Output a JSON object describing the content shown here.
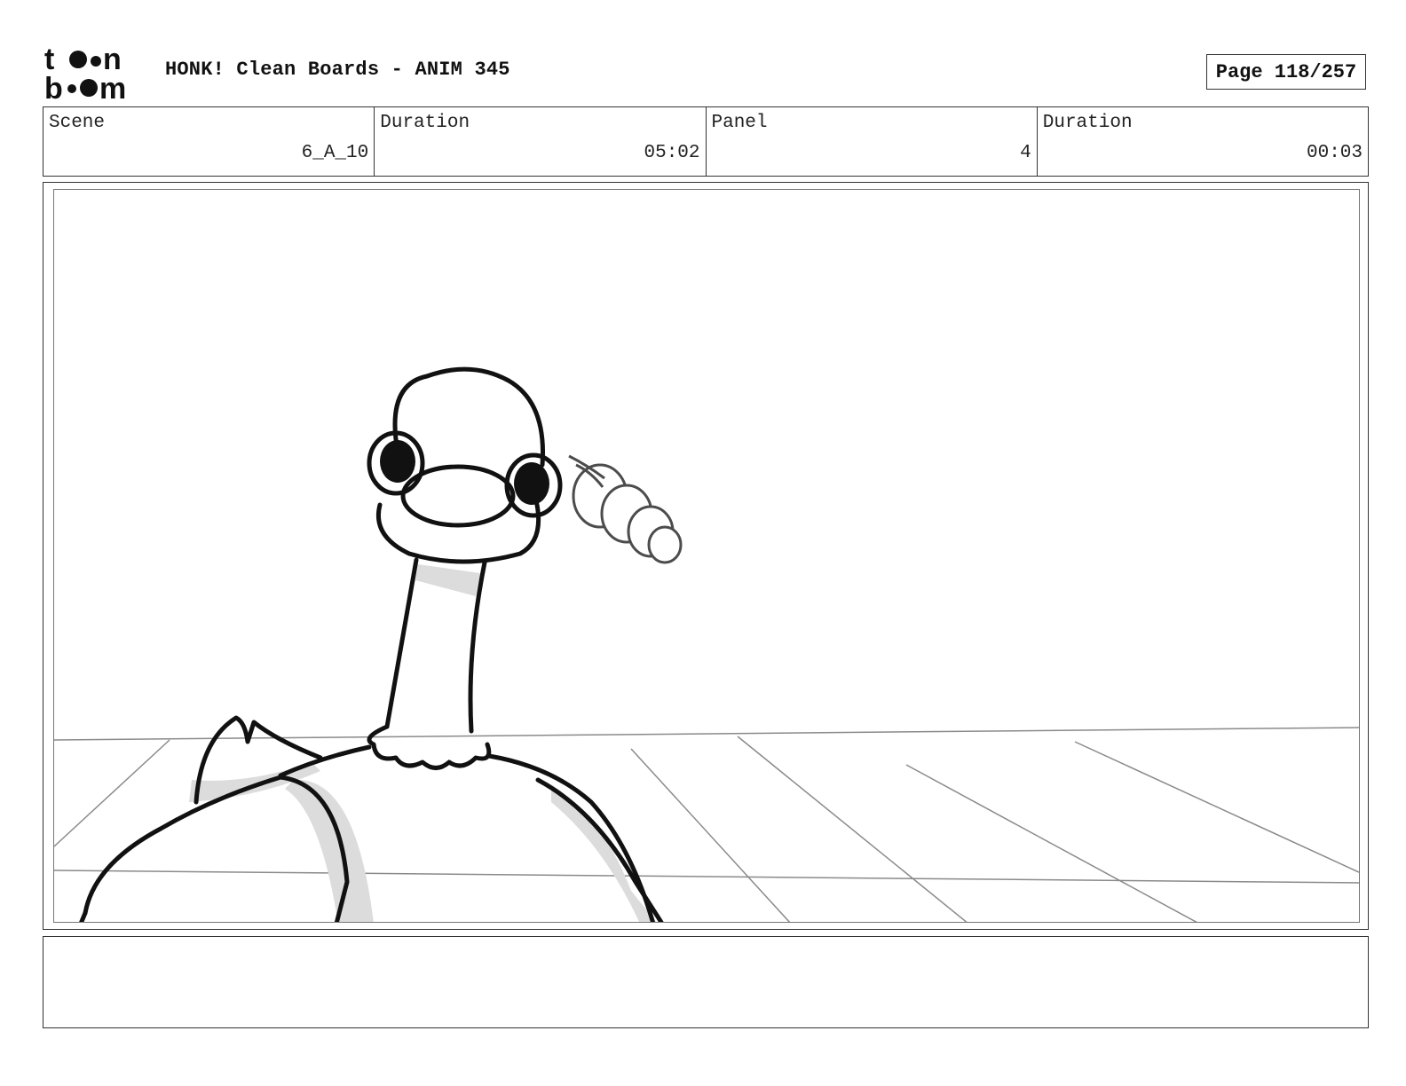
{
  "logo": {
    "line1": "to•n",
    "line2": "b••m",
    "icon": "toon-boom-logo"
  },
  "header": {
    "title": "HONK! Clean Boards - ANIM 345",
    "page_label": "Page 118/257"
  },
  "info": {
    "scene_label": "Scene",
    "scene_value": "6_A_10",
    "duration_label": "Duration",
    "duration_value": "05:02",
    "panel_label": "Panel",
    "panel_value": "4",
    "panel_duration_label": "Duration",
    "panel_duration_value": "00:03"
  },
  "panel": {
    "icon": "goose-sketch-drawing"
  },
  "notes": {
    "text": ""
  },
  "colors": {
    "ink": "#111111",
    "shade": "#dcdcdc",
    "floor_lines": "#8a8a8a"
  }
}
